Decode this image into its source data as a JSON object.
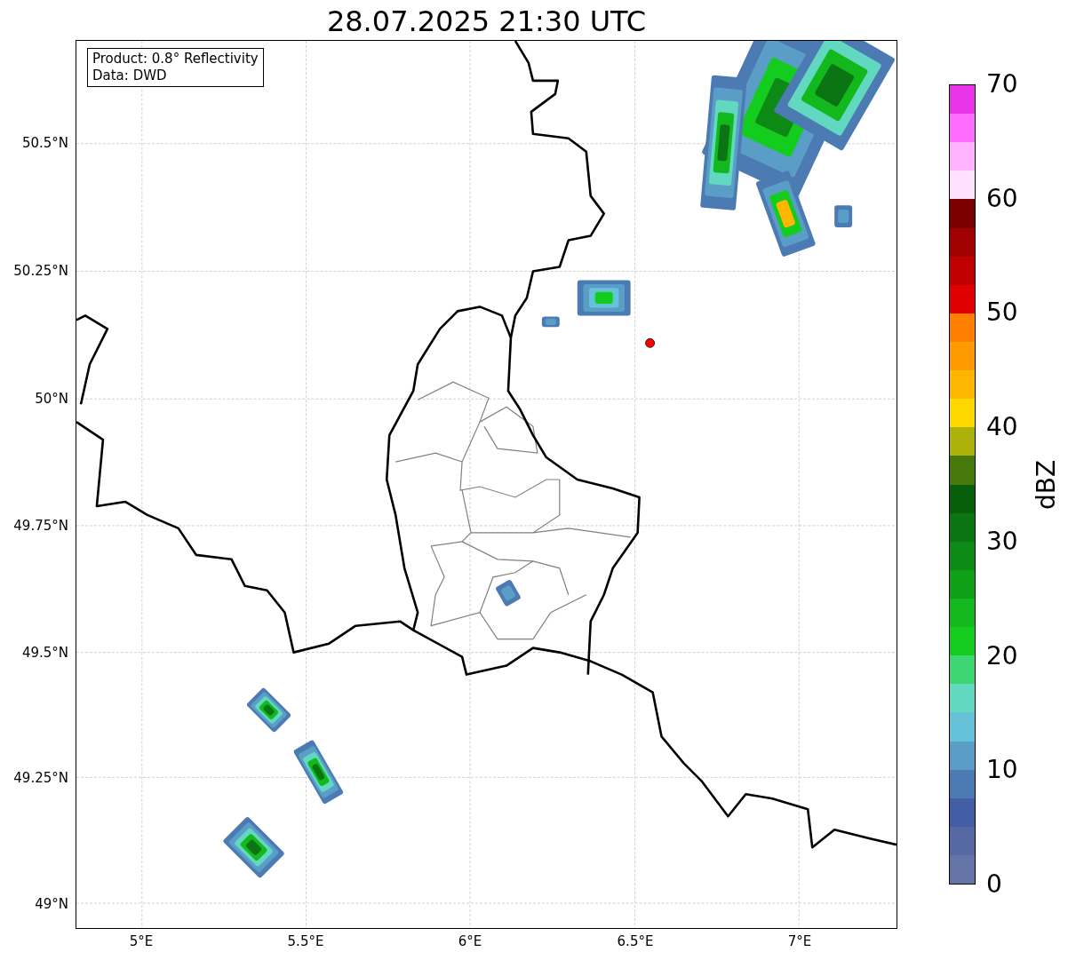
{
  "title": "28.07.2025 21:30 UTC",
  "info_box": {
    "lines": [
      "Product: 0.8° Reflectivity",
      "Data: DWD"
    ]
  },
  "map": {
    "y_ticks": [
      "50.5°N",
      "50.25°N",
      "50°N",
      "49.75°N",
      "49.5°N",
      "49.25°N",
      "49°N"
    ],
    "x_ticks": [
      "5°E",
      "5.5°E",
      "6°E",
      "6.5°E",
      "7°E"
    ]
  },
  "colorbar": {
    "label": "dBZ",
    "ticks": [
      "70",
      "60",
      "50",
      "40",
      "30",
      "20",
      "10",
      "0"
    ],
    "bins": [
      {
        "color": "#e833e8"
      },
      {
        "color": "#ff6bff"
      },
      {
        "color": "#ffb3ff"
      },
      {
        "color": "#ffe0ff"
      },
      {
        "color": "#7a0000"
      },
      {
        "color": "#a00000"
      },
      {
        "color": "#c00000"
      },
      {
        "color": "#e00000"
      },
      {
        "color": "#ff8000"
      },
      {
        "color": "#ff9a00"
      },
      {
        "color": "#ffb600"
      },
      {
        "color": "#ffd800"
      },
      {
        "color": "#adb20a"
      },
      {
        "color": "#457a0b"
      },
      {
        "color": "#075f0c"
      },
      {
        "color": "#0b7514"
      },
      {
        "color": "#0d8a16"
      },
      {
        "color": "#10a018"
      },
      {
        "color": "#12b81c"
      },
      {
        "color": "#14cc1e"
      },
      {
        "color": "#3dd672"
      },
      {
        "color": "#62d8c0"
      },
      {
        "color": "#66c2d8"
      },
      {
        "color": "#5a9ec8"
      },
      {
        "color": "#4c7bb3"
      },
      {
        "color": "#445ea5"
      },
      {
        "color": "#5669a2"
      },
      {
        "color": "#6574a6"
      }
    ]
  }
}
